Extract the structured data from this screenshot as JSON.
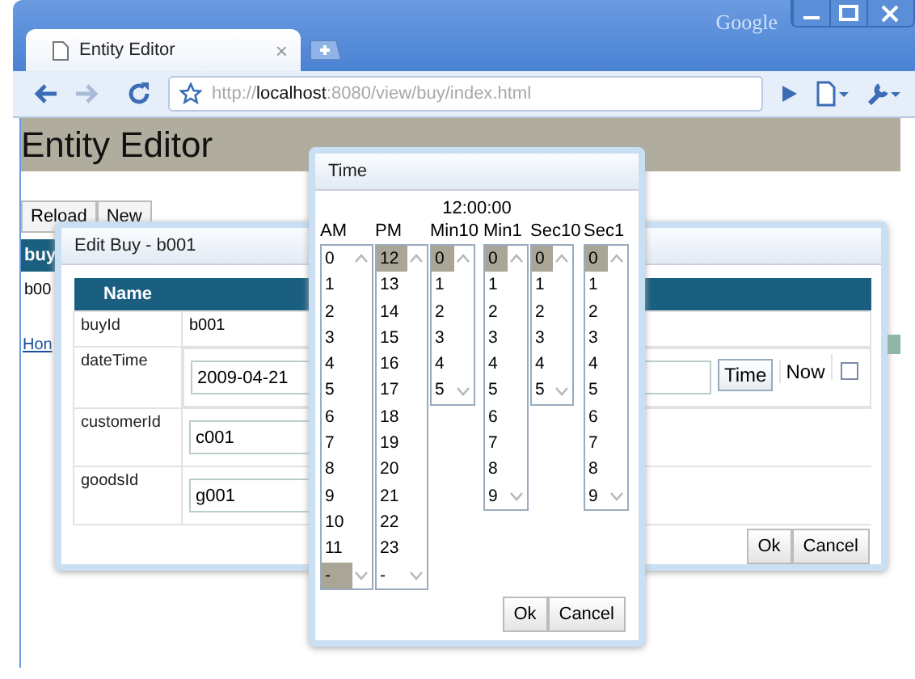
{
  "browser": {
    "brand": "Google",
    "tab": {
      "title": "Entity Editor",
      "close": "×"
    },
    "address": {
      "scheme": "http://",
      "host": "localhost",
      "path": ":8080/view/buy/index.html"
    }
  },
  "page": {
    "heading": "Entity Editor",
    "buttons": [
      "Reload",
      "New"
    ],
    "list_header": "buy",
    "list_row": "b00",
    "link": "Hon"
  },
  "edit_dialog": {
    "title": "Edit Buy - b001",
    "columns": [
      "Name"
    ],
    "rows": [
      {
        "kind": "text",
        "name": "buyId",
        "value": "b001"
      },
      {
        "kind": "datetime",
        "name": "dateTime",
        "value": "2009-04-21",
        "time_button": "Time",
        "now_label": "Now",
        "now_checked": false
      },
      {
        "kind": "input",
        "name": "customerId",
        "value": "c001"
      },
      {
        "kind": "input",
        "name": "goodsId",
        "value": "g001"
      }
    ],
    "buttons": [
      "Ok",
      "Cancel"
    ]
  },
  "time_dialog": {
    "title": "Time",
    "time": "12:00:00",
    "columns": [
      {
        "label": "AM",
        "options": [
          {
            "text": "0",
            "selected": false
          },
          {
            "text": "1",
            "selected": false
          },
          {
            "text": "2",
            "selected": false
          },
          {
            "text": "3",
            "selected": false
          },
          {
            "text": "4",
            "selected": false
          },
          {
            "text": "5",
            "selected": false
          },
          {
            "text": "6",
            "selected": false
          },
          {
            "text": "7",
            "selected": false
          },
          {
            "text": "8",
            "selected": false
          },
          {
            "text": "9",
            "selected": false
          },
          {
            "text": "10",
            "selected": false
          },
          {
            "text": "11",
            "selected": false
          },
          {
            "text": "-",
            "selected": true
          }
        ]
      },
      {
        "label": "PM",
        "options": [
          {
            "text": "12",
            "selected": true
          },
          {
            "text": "13",
            "selected": false
          },
          {
            "text": "14",
            "selected": false
          },
          {
            "text": "15",
            "selected": false
          },
          {
            "text": "16",
            "selected": false
          },
          {
            "text": "17",
            "selected": false
          },
          {
            "text": "18",
            "selected": false
          },
          {
            "text": "19",
            "selected": false
          },
          {
            "text": "20",
            "selected": false
          },
          {
            "text": "21",
            "selected": false
          },
          {
            "text": "22",
            "selected": false
          },
          {
            "text": "23",
            "selected": false
          },
          {
            "text": "-",
            "selected": false
          }
        ]
      },
      {
        "label": "Min10",
        "options": [
          {
            "text": "0",
            "selected": true
          },
          {
            "text": "1",
            "selected": false
          },
          {
            "text": "2",
            "selected": false
          },
          {
            "text": "3",
            "selected": false
          },
          {
            "text": "4",
            "selected": false
          },
          {
            "text": "5",
            "selected": false
          }
        ]
      },
      {
        "label": "Min1",
        "options": [
          {
            "text": "0",
            "selected": true
          },
          {
            "text": "1",
            "selected": false
          },
          {
            "text": "2",
            "selected": false
          },
          {
            "text": "3",
            "selected": false
          },
          {
            "text": "4",
            "selected": false
          },
          {
            "text": "5",
            "selected": false
          },
          {
            "text": "6",
            "selected": false
          },
          {
            "text": "7",
            "selected": false
          },
          {
            "text": "8",
            "selected": false
          },
          {
            "text": "9",
            "selected": false
          }
        ]
      },
      {
        "label": "Sec10",
        "options": [
          {
            "text": "0",
            "selected": true
          },
          {
            "text": "1",
            "selected": false
          },
          {
            "text": "2",
            "selected": false
          },
          {
            "text": "3",
            "selected": false
          },
          {
            "text": "4",
            "selected": false
          },
          {
            "text": "5",
            "selected": false
          }
        ]
      },
      {
        "label": "Sec1",
        "options": [
          {
            "text": "0",
            "selected": true
          },
          {
            "text": "1",
            "selected": false
          },
          {
            "text": "2",
            "selected": false
          },
          {
            "text": "3",
            "selected": false
          },
          {
            "text": "4",
            "selected": false
          },
          {
            "text": "5",
            "selected": false
          },
          {
            "text": "6",
            "selected": false
          },
          {
            "text": "7",
            "selected": false
          },
          {
            "text": "8",
            "selected": false
          },
          {
            "text": "9",
            "selected": false
          }
        ]
      }
    ],
    "buttons": [
      "Ok",
      "Cancel"
    ]
  }
}
